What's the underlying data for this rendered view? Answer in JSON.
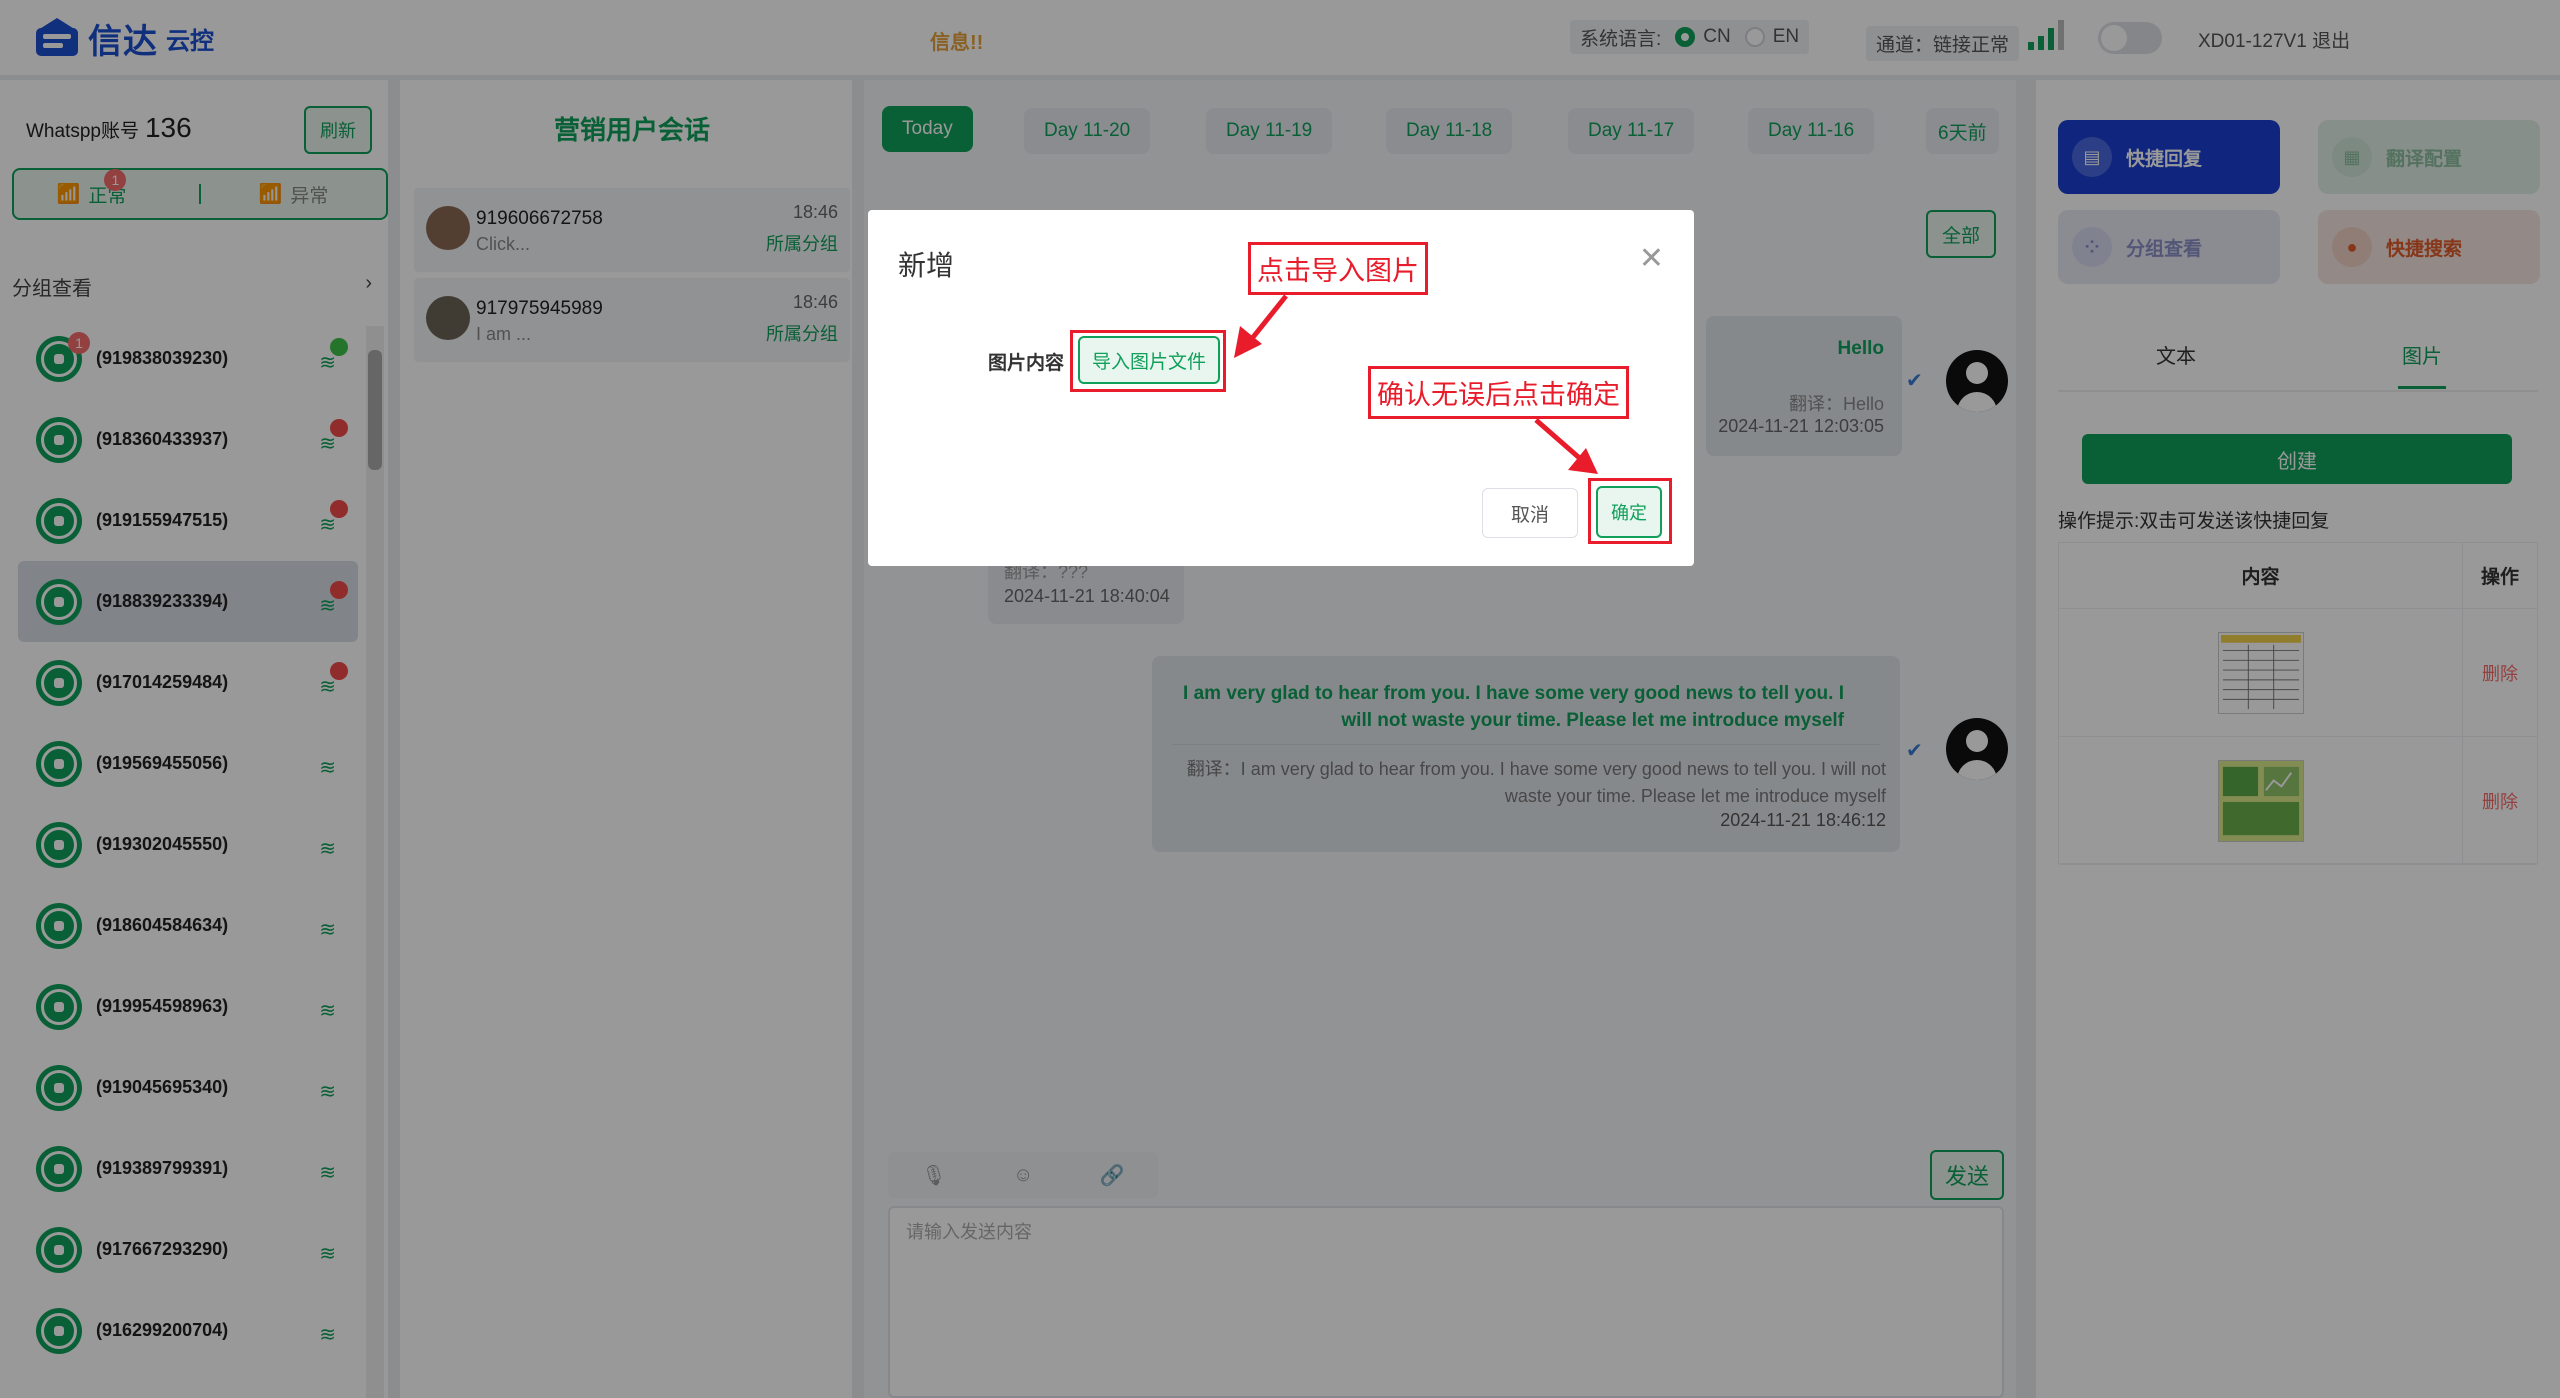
{
  "app": {
    "logo_name": "信达",
    "logo_sub": "云控",
    "notice": "信息!!"
  },
  "header": {
    "lang_label": "系统语言:",
    "lang_cn": "CN",
    "lang_en": "EN",
    "channel": "通道：链接正常",
    "user": "XD01-127V1 退出"
  },
  "sidebar": {
    "account_label": "Whatspp账号",
    "account_count": "136",
    "refresh": "刷新",
    "tab_normal": "正常",
    "tab_normal_badge": "1",
    "tab_abnormal": "异常",
    "group_view": "分组查看",
    "contacts": [
      {
        "num": "(919838039230)",
        "status": "green",
        "badge": "1"
      },
      {
        "num": "(918360433937)",
        "status": "red"
      },
      {
        "num": "(919155947515)",
        "status": "red"
      },
      {
        "num": "(918839233394)",
        "status": "red",
        "selected": true
      },
      {
        "num": "(917014259484)",
        "status": "red"
      },
      {
        "num": "(919569455056)",
        "status": "none"
      },
      {
        "num": "(919302045550)",
        "status": "none"
      },
      {
        "num": "(918604584634)",
        "status": "none"
      },
      {
        "num": "(919954598963)",
        "status": "none"
      },
      {
        "num": "(919045695340)",
        "status": "none"
      },
      {
        "num": "(919389799391)",
        "status": "none"
      },
      {
        "num": "(917667293290)",
        "status": "none"
      },
      {
        "num": "(916299200704)",
        "status": "none"
      }
    ]
  },
  "sessions": {
    "title": "营销用户会话",
    "items": [
      {
        "phone": "919606672758",
        "msg": "Click...",
        "time": "18:46",
        "group": "所属分组"
      },
      {
        "phone": "917975945989",
        "msg": "I am ...",
        "time": "18:46",
        "group": "所属分组"
      }
    ]
  },
  "chat": {
    "days": [
      "Today",
      "Day 11-20",
      "Day 11-19",
      "Day 11-18",
      "Day 11-17",
      "Day 11-16",
      "6天前"
    ],
    "all_button": "全部",
    "msg1": {
      "text": "Hello",
      "translation": "翻译：Hello",
      "time": "2024-11-21 12:03:05"
    },
    "msg2": {
      "translation": "翻译：???",
      "time": "2024-11-21 18:40:04"
    },
    "msg3": {
      "text": "I am very glad to hear from you. I have some very good news to tell you. I will not waste your time. Please let me introduce myself",
      "translation": "翻译：I am very glad to hear from you. I have some very good news to tell you. I will not waste your time. Please let me introduce myself",
      "time": "2024-11-21 18:46:12"
    },
    "send": "发送",
    "placeholder": "请输入发送内容"
  },
  "right": {
    "quick_reply": "快捷回复",
    "translate_config": "翻译配置",
    "group_view": "分组查看",
    "quick_search": "快捷搜索",
    "tab_text": "文本",
    "tab_image": "图片",
    "create": "创建",
    "hint": "操作提示:双击可发送该快捷回复",
    "col_content": "内容",
    "col_action": "操作",
    "delete": "删除"
  },
  "modal": {
    "title": "新增",
    "field_label": "图片内容",
    "import_button": "导入图片文件",
    "cancel": "取消",
    "confirm": "确定"
  },
  "annotations": {
    "import_tip": "点击导入图片",
    "confirm_tip": "确认无误后点击确定"
  },
  "colors": {
    "brand": "#10a05a",
    "logo": "#1b4fd1",
    "annotation": "#e81c2a",
    "danger": "#f56c6c"
  }
}
